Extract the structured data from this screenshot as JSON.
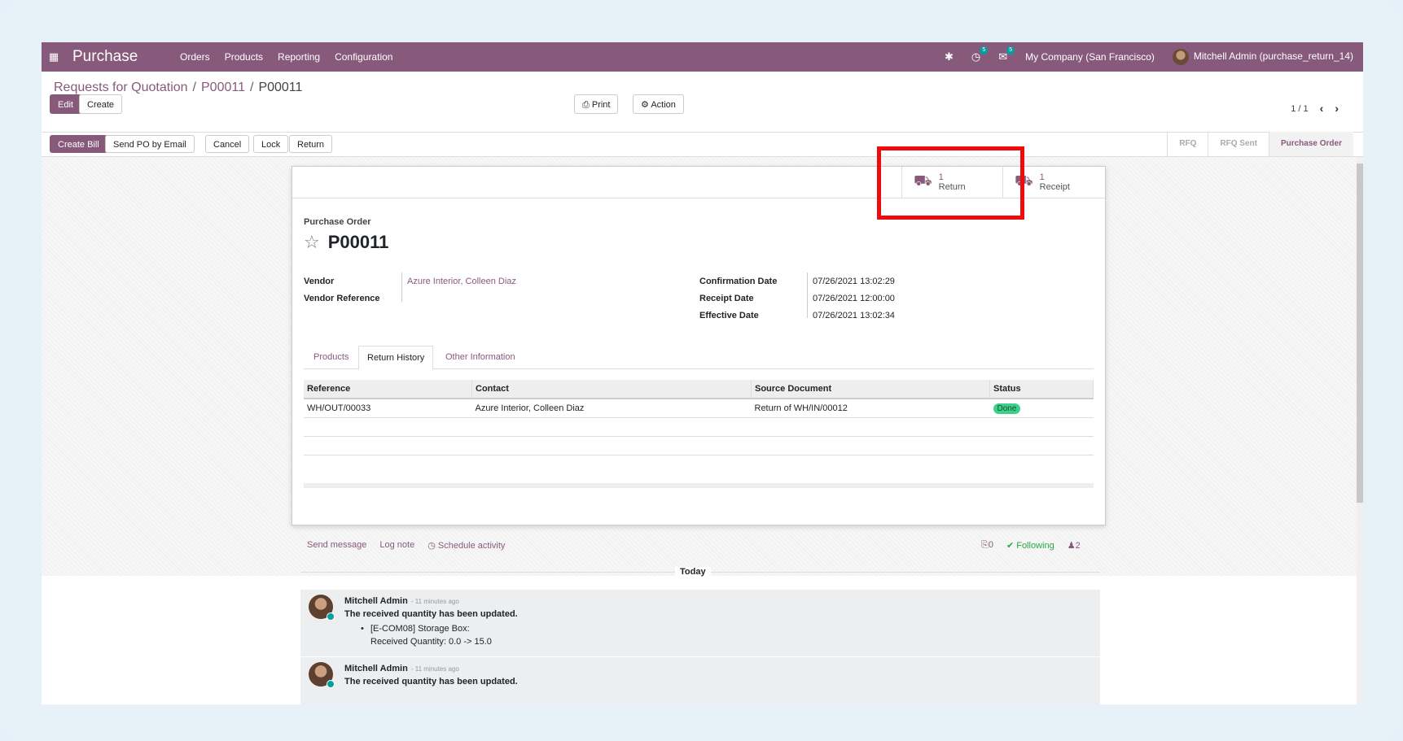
{
  "navbar": {
    "app_name": "Purchase",
    "menu": [
      "Orders",
      "Products",
      "Reporting",
      "Configuration"
    ],
    "activity_count": "5",
    "message_count": "5",
    "company": "My Company (San Francisco)",
    "user": "Mitchell Admin (purchase_return_14)"
  },
  "breadcrumb": [
    "Requests for Quotation",
    "P00011",
    "P00011"
  ],
  "control": {
    "edit": "Edit",
    "create": "Create",
    "print": "Print",
    "action": "Action",
    "pager": "1 / 1"
  },
  "statusbar": {
    "buttons": [
      "Create Bill",
      "Send PO by Email",
      "Cancel",
      "Lock",
      "Return"
    ],
    "steps": [
      "RFQ",
      "RFQ Sent",
      "Purchase Order"
    ],
    "active_step": "Purchase Order"
  },
  "smart_buttons": [
    {
      "value": "1",
      "label": "Return"
    },
    {
      "value": "1",
      "label": "Receipt"
    }
  ],
  "form": {
    "kind": "Purchase Order",
    "name": "P00011",
    "vendor_label": "Vendor",
    "vendor": "Azure Interior, Colleen Diaz",
    "vendor_ref_label": "Vendor Reference",
    "vendor_ref": "",
    "confirmation_label": "Confirmation Date",
    "confirmation": "07/26/2021 13:02:29",
    "receipt_label": "Receipt Date",
    "receipt": "07/26/2021 12:00:00",
    "effective_label": "Effective Date",
    "effective": "07/26/2021 13:02:34"
  },
  "tabs": [
    "Products",
    "Return History",
    "Other Information"
  ],
  "active_tab": "Return History",
  "return_table": {
    "columns": [
      "Reference",
      "Contact",
      "Source Document",
      "Status"
    ],
    "rows": [
      {
        "reference": "WH/OUT/00033",
        "contact": "Azure Interior, Colleen Diaz",
        "source": "Return of WH/IN/00012",
        "status": "Done"
      }
    ]
  },
  "chatter": {
    "send_message": "Send message",
    "log_note": "Log note",
    "schedule": "Schedule activity",
    "attachments": "0",
    "following": "Following",
    "followers": "2",
    "today": "Today",
    "messages": [
      {
        "author": "Mitchell Admin",
        "time": "- 11 minutes ago",
        "body": "The received quantity has been updated.",
        "item": "[E-COM08] Storage Box:",
        "change": "Received Quantity: 0.0 -> 15.0"
      },
      {
        "author": "Mitchell Admin",
        "time": "- 11 minutes ago",
        "body": "The received quantity has been updated."
      }
    ]
  },
  "colors": {
    "brand": "#875a7b",
    "highlight": "#ee0b0b",
    "done": "#3dd08b"
  }
}
